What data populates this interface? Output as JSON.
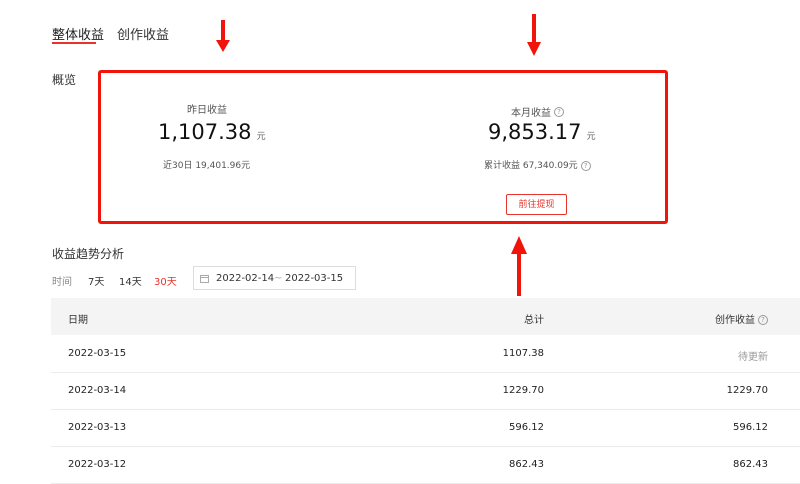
{
  "tabs": [
    {
      "label": "整体收益",
      "active": true
    },
    {
      "label": "创作收益",
      "active": false
    }
  ],
  "overview": {
    "title": "概览",
    "yesterday": {
      "label": "昨日收益",
      "value": "1,107.38",
      "unit": "元",
      "sub": "近30日 19,401.96元"
    },
    "month": {
      "label": "本月收益",
      "value": "9,853.17",
      "unit": "元",
      "sub": "累计收益 67,340.09元"
    },
    "withdraw_button": "前往提现"
  },
  "trend": {
    "title": "收益趋势分析",
    "time_label": "时间",
    "ranges": [
      {
        "label": "7天",
        "active": false
      },
      {
        "label": "14天",
        "active": false
      },
      {
        "label": "30天",
        "active": true
      }
    ],
    "date_start": "2022-02-14",
    "date_sep": "~",
    "date_end": "2022-03-15"
  },
  "table": {
    "headers": {
      "date": "日期",
      "total": "总计",
      "creation": "创作收益"
    },
    "rows": [
      {
        "date": "2022-03-15",
        "total": "1107.38",
        "creation": "待更新"
      },
      {
        "date": "2022-03-14",
        "total": "1229.70",
        "creation": "1229.70"
      },
      {
        "date": "2022-03-13",
        "total": "596.12",
        "creation": "596.12"
      },
      {
        "date": "2022-03-12",
        "total": "862.43",
        "creation": "862.43"
      }
    ]
  },
  "colors": {
    "accent": "#e8332a",
    "annotation_red": "#f0140a"
  },
  "icons": {
    "help": "question-circle-icon",
    "calendar": "calendar-icon"
  }
}
